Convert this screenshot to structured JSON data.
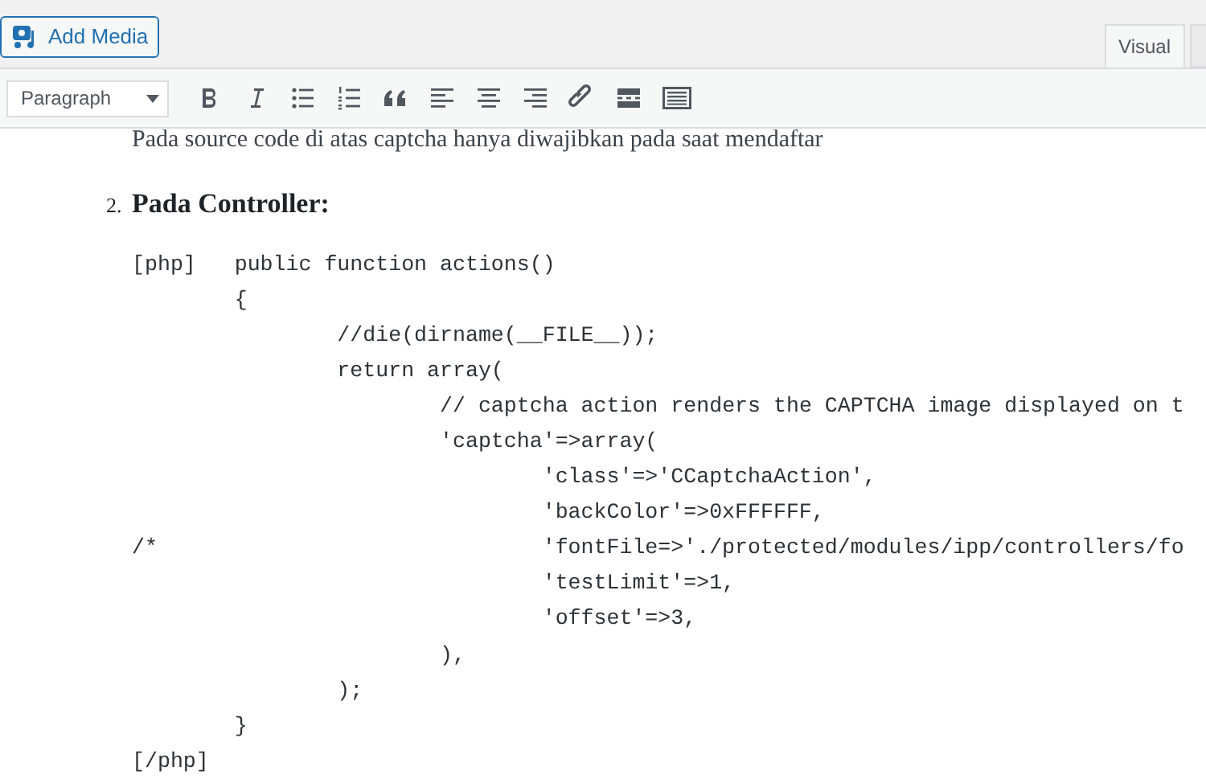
{
  "add_media": {
    "label": "Add Media"
  },
  "tabs": [
    {
      "label": "Visual",
      "selected": true
    }
  ],
  "toolbar": {
    "format": "Paragraph"
  },
  "content": {
    "partial_paragraph": "Pada source code di atas captcha hanya diwajibkan pada saat mendaftar",
    "list_item": {
      "number": "2.",
      "heading": "Pada Controller:"
    },
    "code_lines": [
      "[php]\tpublic function actions()",
      "\t{",
      "\t\t//die(dirname(__FILE__));",
      "\t\treturn array(",
      "\t\t\t// captcha action renders the CAPTCHA image displayed on t",
      "\t\t\t'captcha'=>array(",
      "\t\t\t\t'class'=>'CCaptchaAction',",
      "\t\t\t\t'backColor'=>0xFFFFFF,",
      "/*\t\t\t\t'fontFile=>'./protected/modules/ipp/controllers/fo",
      "\t\t\t\t'testLimit'=>1,",
      "\t\t\t\t'offset'=>3,",
      "\t\t\t),",
      "\t\t);",
      "\t}",
      "[/php]"
    ]
  }
}
